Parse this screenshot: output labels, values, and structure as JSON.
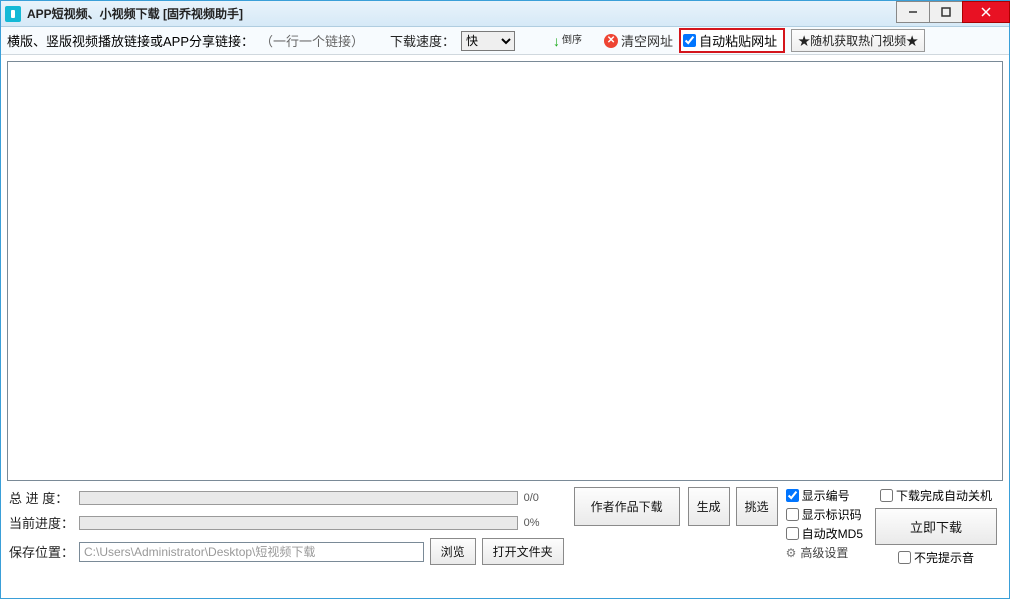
{
  "titlebar": {
    "title": "APP短视频、小视频下载 [固乔视频助手]"
  },
  "toolbar": {
    "prompt": "横版、竖版视频播放链接或APP分享链接：",
    "hint": "（一行一个链接）",
    "speed_label": "下载速度：",
    "speed_value": "快",
    "reverse_label": "倒序",
    "clear_label": "清空网址",
    "autopaste_label": "自动粘贴网址",
    "random_label": "★随机获取热门视频★"
  },
  "progress": {
    "total_label": "总 进 度：",
    "total_text": "0/0",
    "current_label": "当前进度：",
    "current_text": "0%"
  },
  "save": {
    "label": "保存位置：",
    "path": "C:\\Users\\Administrator\\Desktop\\短视频下载",
    "browse": "浏览",
    "open_folder": "打开文件夹"
  },
  "buttons": {
    "author_works": "作者作品下载",
    "generate": "生成",
    "pick": "挑选",
    "download_now": "立即下载"
  },
  "checks": {
    "show_index": "显示编号",
    "show_flag": "显示标识码",
    "auto_md5": "自动改MD5",
    "advanced": "高级设置",
    "auto_shutdown": "下载完成自动关机",
    "no_sound": "不完提示音"
  }
}
